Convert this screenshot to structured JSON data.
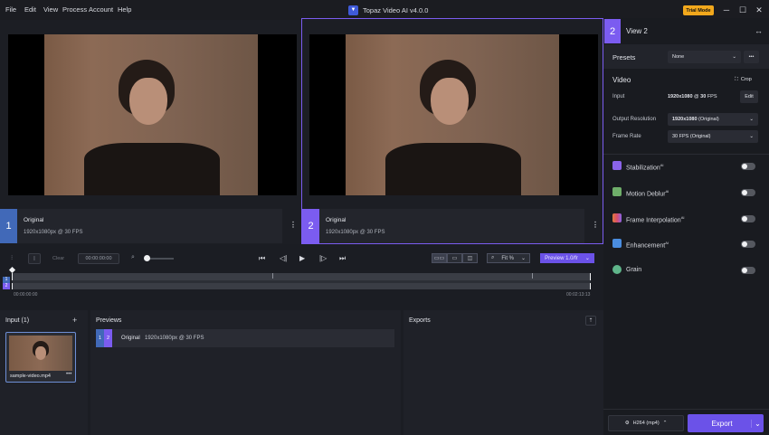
{
  "menu": {
    "file": "File",
    "edit": "Edit",
    "view": "View",
    "process": "Process",
    "account": "Account",
    "help": "Help"
  },
  "window": {
    "title": "Topaz Video AI  v4.0.0",
    "trial": "Trial Mode"
  },
  "views": [
    {
      "number": "1",
      "title": "Original",
      "subtitle": "1920x1080px @ 30 FPS"
    },
    {
      "number": "2",
      "title": "Original",
      "subtitle": "1920x1080px @ 30 FPS"
    }
  ],
  "toolbar": {
    "clear": "Clear",
    "timecode": "00:00:00:00",
    "fit": "Fit %",
    "preview": "Preview 1.0/fr"
  },
  "timeline": {
    "start": "00:00:00:00",
    "end": "00:02:13:13",
    "track1": "1",
    "track2": "2"
  },
  "input": {
    "title": "Input (1)",
    "file": "sample-video.mp4"
  },
  "previews": {
    "title": "Previews",
    "row_num1": "1",
    "row_num2": "2",
    "row_title": "Original",
    "row_sub": "1920x1080px @ 30 FPS"
  },
  "exports": {
    "title": "Exports"
  },
  "right": {
    "view_number": "2",
    "view_title": "View 2",
    "presets_label": "Presets",
    "presets_value": "None",
    "video_label": "Video",
    "crop_label": "Crop",
    "input_label": "Input",
    "input_res": "1920x1080",
    "input_at": " @ ",
    "input_fps": "30",
    "input_fps_unit": " FPS",
    "edit_label": "Edit",
    "output_label": "Output Resolution",
    "output_value": "1920x1080",
    "output_suffix": " (Original)",
    "framerate_label": "Frame Rate",
    "framerate_value": "30 FPS (Original)",
    "features": [
      {
        "name": "Stabilization",
        "ai": "AI",
        "color": "#8a63e8"
      },
      {
        "name": "Motion Deblur",
        "ai": "AI",
        "color": "#6fae6a"
      },
      {
        "name": "Frame Interpolation",
        "ai": "AI",
        "color": "#e07a3c"
      },
      {
        "name": "Enhancement",
        "ai": "AI",
        "color": "#4a8de0"
      },
      {
        "name": "Grain",
        "ai": "",
        "color": "#5fb58a"
      }
    ],
    "format": "H264 (mp4)",
    "export": "Export"
  },
  "colors": {
    "accent": "#6b52e8",
    "view1": "#4169b8",
    "view2": "#7b5cf0",
    "trial": "#f2a81c"
  }
}
